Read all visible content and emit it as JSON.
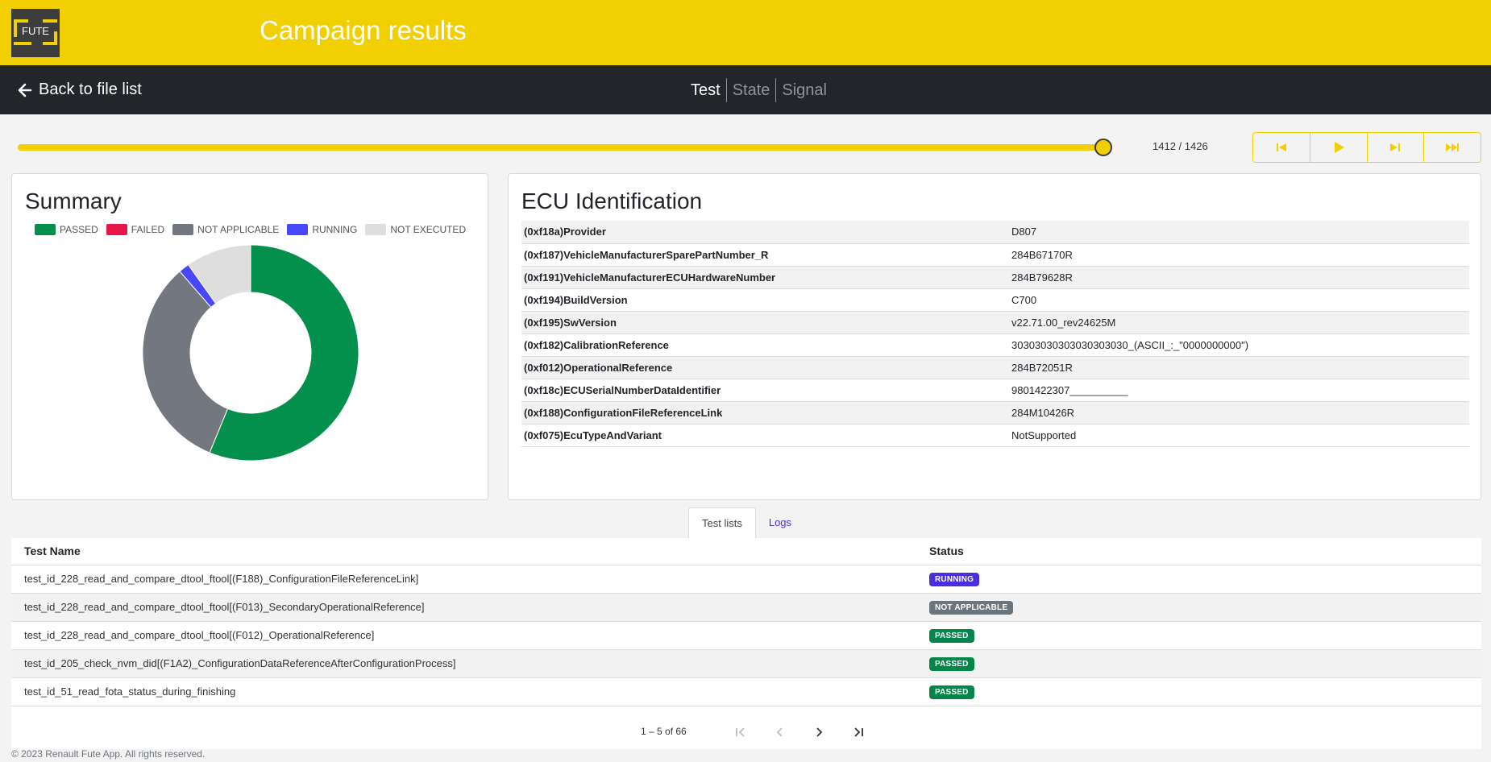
{
  "header": {
    "logo_text": "FUTE",
    "title": "Campaign results"
  },
  "nav": {
    "back_label": "Back to file list",
    "tabs": [
      {
        "label": "Test",
        "active": true
      },
      {
        "label": "State",
        "active": false
      },
      {
        "label": "Signal",
        "active": false
      }
    ]
  },
  "player": {
    "current": 1412,
    "total": 1426,
    "counter": "1412 / 1426",
    "buttons": [
      "skip-start-icon",
      "play-icon",
      "step-forward-icon",
      "fast-forward-icon"
    ]
  },
  "summary": {
    "title": "Summary",
    "legend": [
      {
        "label": "PASSED",
        "color": "#02904c"
      },
      {
        "label": "FAILED",
        "color": "#e8174a"
      },
      {
        "label": "NOT APPLICABLE",
        "color": "#737780"
      },
      {
        "label": "RUNNING",
        "color": "#4747ff"
      },
      {
        "label": "NOT EXECUTED",
        "color": "#dedede"
      }
    ],
    "slices": [
      {
        "label": "PASSED",
        "value": 56.2,
        "color": "#02904c"
      },
      {
        "label": "FAILED",
        "value": 0,
        "color": "#e8174a"
      },
      {
        "label": "NOT APPLICABLE",
        "value": 32.4,
        "color": "#737780"
      },
      {
        "label": "RUNNING",
        "value": 1.6,
        "color": "#4747ff"
      },
      {
        "label": "NOT EXECUTED",
        "value": 9.8,
        "color": "#dedede"
      }
    ]
  },
  "ecu": {
    "title": "ECU Identification",
    "rows": [
      {
        "key": "(0xf18a)Provider",
        "value": "D807"
      },
      {
        "key": "(0xf187)VehicleManufacturerSparePartNumber_R",
        "value": "284B67170R"
      },
      {
        "key": "(0xf191)VehicleManufacturerECUHardwareNumber",
        "value": "284B79628R"
      },
      {
        "key": "(0xf194)BuildVersion",
        "value": "C700"
      },
      {
        "key": "(0xf195)SwVersion",
        "value": "v22.71.00_rev24625M"
      },
      {
        "key": "(0xf182)CalibrationReference",
        "value": "30303030303030303030_(ASCII_:_\"0000000000\")"
      },
      {
        "key": "(0xf012)OperationalReference",
        "value": "284B72051R"
      },
      {
        "key": "(0xf18c)ECUSerialNumberDataIdentifier",
        "value": "9801422307__________"
      },
      {
        "key": "(0xf188)ConfigurationFileReferenceLink",
        "value": "284M10426R"
      },
      {
        "key": "(0xf075)EcuTypeAndVariant",
        "value": "NotSupported"
      }
    ]
  },
  "results": {
    "tabs": [
      {
        "label": "Test lists",
        "active": true
      },
      {
        "label": "Logs",
        "active": false
      }
    ],
    "columns": {
      "name": "Test Name",
      "status": "Status"
    },
    "rows": [
      {
        "name": "test_id_228_read_and_compare_dtool_ftool[(F188)_ConfigurationFileReferenceLink]",
        "status": "RUNNING",
        "color": "#4a2fe0"
      },
      {
        "name": "test_id_228_read_and_compare_dtool_ftool[(F013)_SecondaryOperationalReference]",
        "status": "NOT APPLICABLE",
        "color": "#6c757d"
      },
      {
        "name": "test_id_228_read_and_compare_dtool_ftool[(F012)_OperationalReference]",
        "status": "PASSED",
        "color": "#04864a"
      },
      {
        "name": "test_id_205_check_nvm_did[(F1A2)_ConfigurationDataReferenceAfterConfigurationProcess]",
        "status": "PASSED",
        "color": "#04864a"
      },
      {
        "name": "test_id_51_read_fota_status_during_finishing",
        "status": "PASSED",
        "color": "#04864a"
      }
    ],
    "pager": {
      "range": "1 – 5 of 66"
    }
  },
  "footer": {
    "text": "© 2023 Renault Fute App. All rights reserved."
  }
}
